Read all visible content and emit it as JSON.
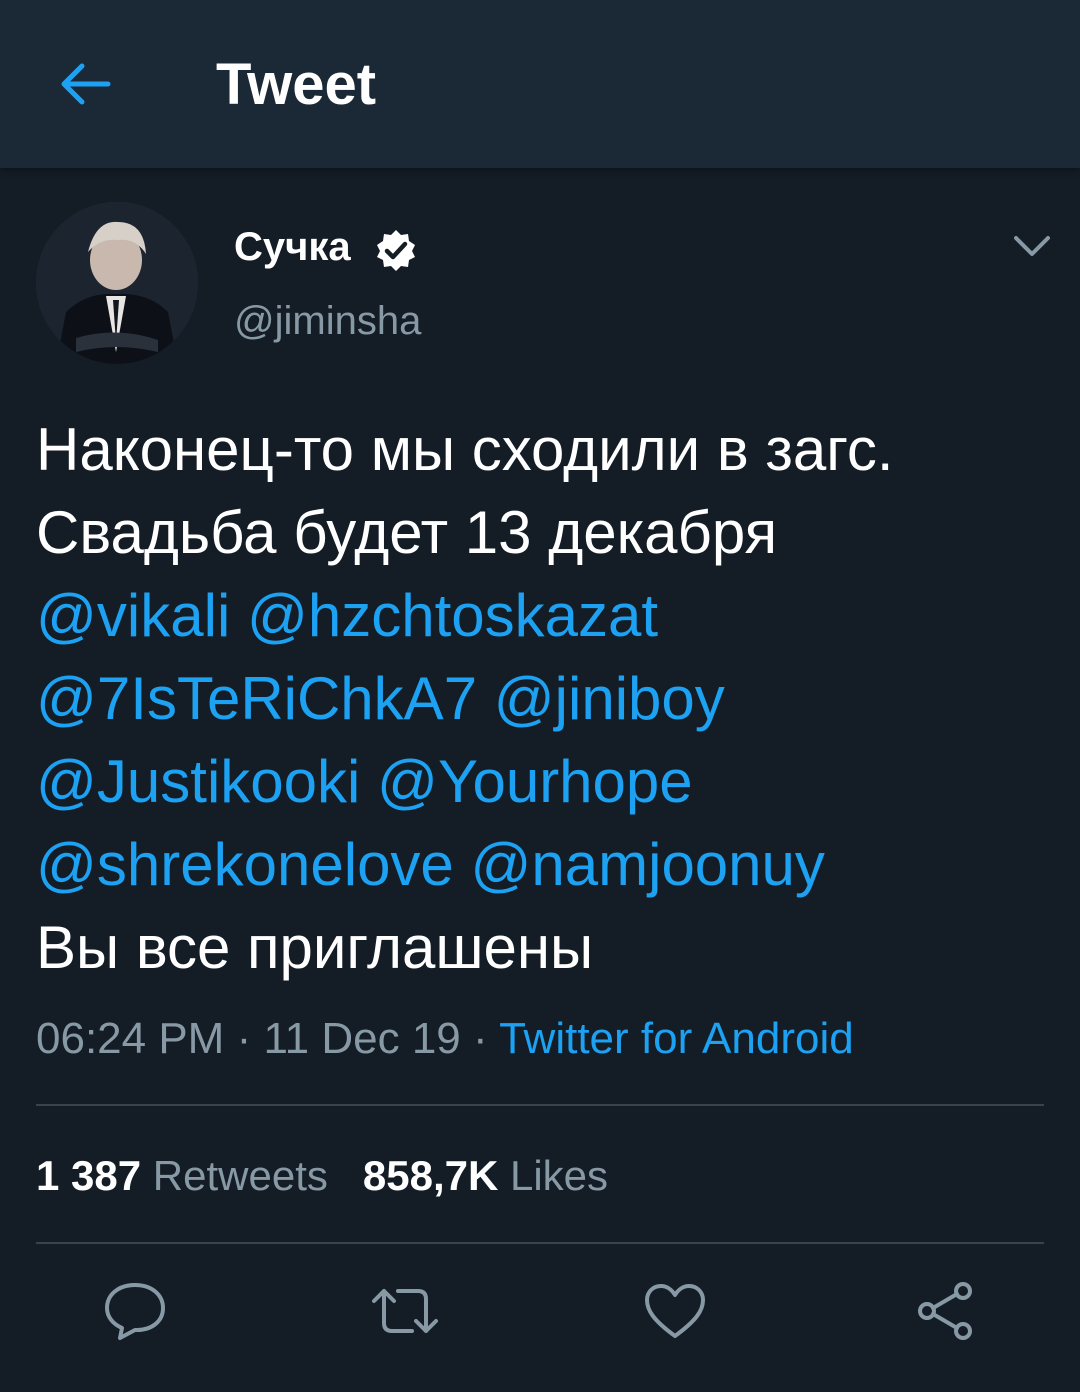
{
  "app_bar": {
    "title": "Tweet",
    "back_icon": "arrow-left-icon",
    "accent": "#1da1f2"
  },
  "author": {
    "name": "Сучка",
    "handle": "@jiminsha",
    "verified_icon": "verified-badge-icon"
  },
  "tweet": {
    "lines": [
      {
        "text": "Наконец-то мы сходили в загс."
      },
      {
        "text": "Свадьба будет 13 декабря"
      }
    ],
    "mentions": [
      "@vikali",
      "@hzchtoskazat",
      "@7IsTeRiChkA7",
      "@jiniboy",
      "@Justikooki",
      "@Yourhope",
      "@shrekonelove",
      "@namjoonuy"
    ],
    "closing": "Вы все приглашены"
  },
  "meta": {
    "time": "06:24 PM",
    "date": "11 Dec 19",
    "separator": "·",
    "source": "Twitter for Android"
  },
  "stats": {
    "retweets_count": "1 387",
    "retweets_label": "Retweets",
    "likes_count": "858,7K",
    "likes_label": "Likes"
  },
  "actions": [
    "reply-icon",
    "retweet-icon",
    "like-icon",
    "share-icon"
  ],
  "colors": {
    "background": "#141d26",
    "header": "#1b2836",
    "muted": "#8899a6",
    "link": "#1da1f2",
    "divider": "#38444d"
  }
}
